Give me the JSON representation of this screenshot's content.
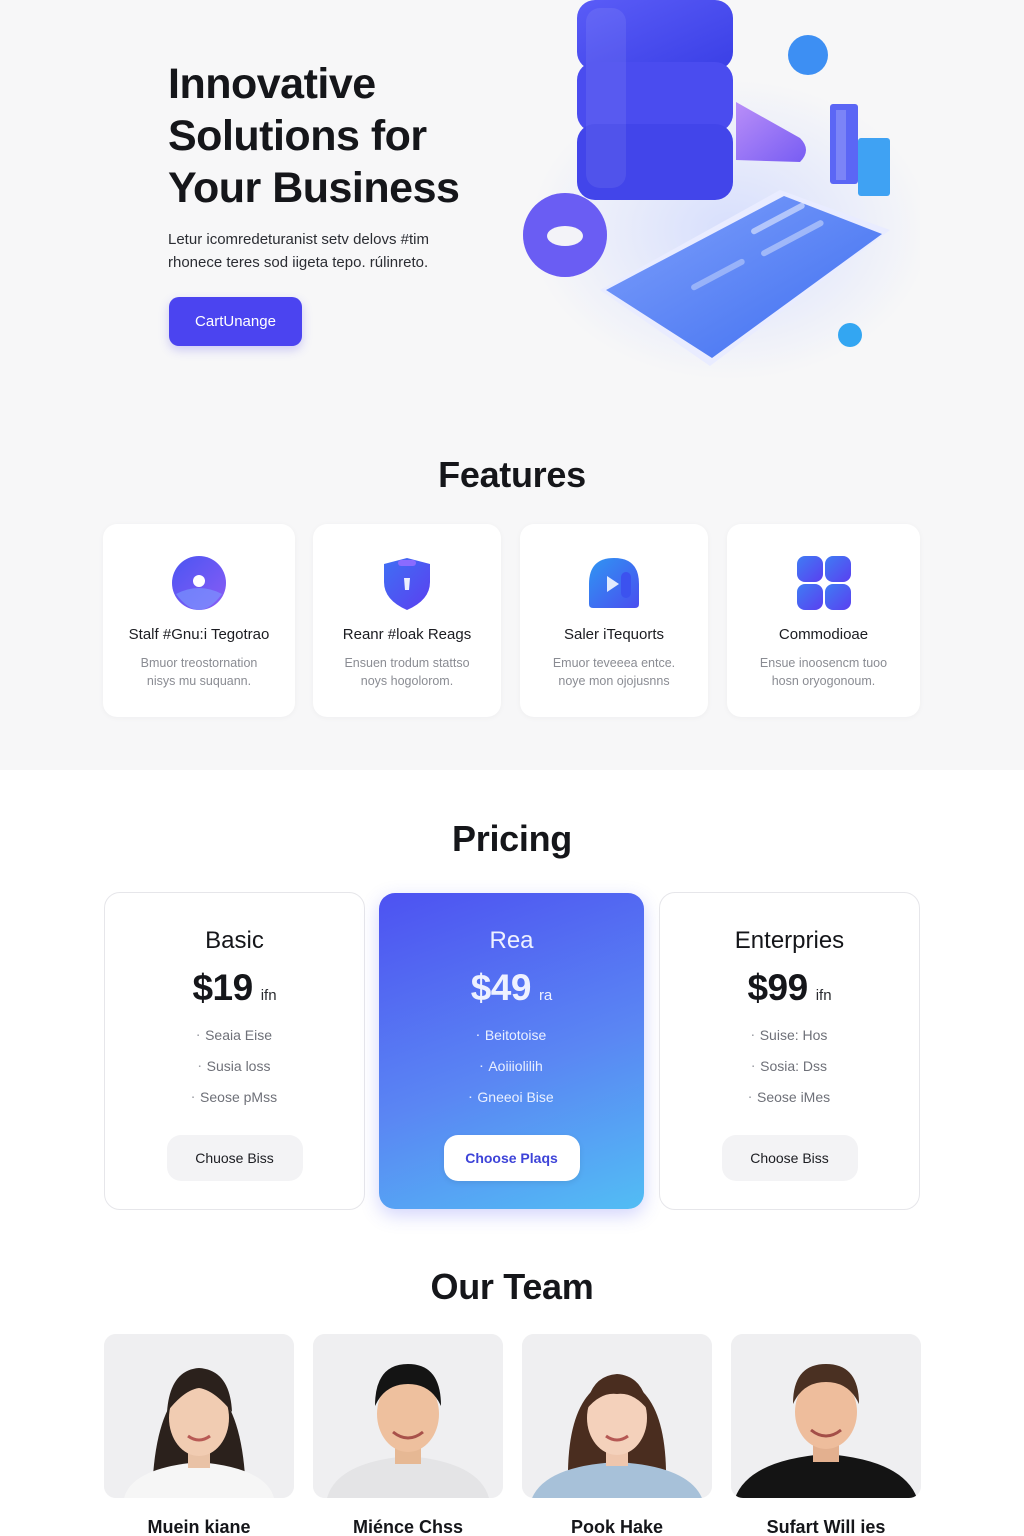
{
  "hero": {
    "title_lines": [
      "Innovative",
      "Solutions for",
      "Your Business"
    ],
    "subtitle_lines": [
      "Letur icomredeturanist setv delovs #tim",
      "rhonece teres sod iigeta tepo. rúlinreto."
    ],
    "cta_label": "CartUnange"
  },
  "features": {
    "title": "Features",
    "items": [
      {
        "title": "Stalf #Gnu:i Tegotrao",
        "desc_lines": [
          "Bmuor treostornation",
          "nisys mu suquann."
        ],
        "icon": "globe-icon"
      },
      {
        "title": "Reanr #loak Reags",
        "desc_lines": [
          "Ensuen trodum stattso",
          "noys hogolorom."
        ],
        "icon": "shield-icon"
      },
      {
        "title": "Saler iTequorts",
        "desc_lines": [
          "Emuor teveeea entce.",
          "noye mon ojojusnns"
        ],
        "icon": "support-icon"
      },
      {
        "title": "Commodioae",
        "desc_lines": [
          "Ensue inoosencm tuoo",
          "hosn oryogonoum."
        ],
        "icon": "apps-icon"
      }
    ]
  },
  "pricing": {
    "title": "Pricing",
    "plans": [
      {
        "name": "Basic",
        "price": "$19",
        "period": "ifn",
        "features": [
          "Seaia Eise",
          "Susia loss",
          "Seose pMss"
        ],
        "button_label": "Chuose Biss",
        "featured": false
      },
      {
        "name": "Rea",
        "price": "$49",
        "period": "ra",
        "features": [
          "Beitotoise",
          "Aoiiiolilih",
          "Gneeoi Bise"
        ],
        "button_label": "Choose Plaqs",
        "featured": true
      },
      {
        "name": "Enterpries",
        "price": "$99",
        "period": "ifn",
        "features": [
          "Suise: Hos",
          "Sosia: Dss",
          "Seose iMes"
        ],
        "button_label": "Choose Biss",
        "featured": false
      }
    ]
  },
  "team": {
    "title": "Our Team",
    "members": [
      {
        "name": "Muein kiane"
      },
      {
        "name": "Miénce Chss"
      },
      {
        "name": "Pook Hake"
      },
      {
        "name": "Sufart Will ies"
      }
    ]
  },
  "colors": {
    "accent": "#4b44f0",
    "gradient_start": "#4d52f2",
    "gradient_end": "#52bdf4",
    "page_bg": "#f7f7f8"
  }
}
